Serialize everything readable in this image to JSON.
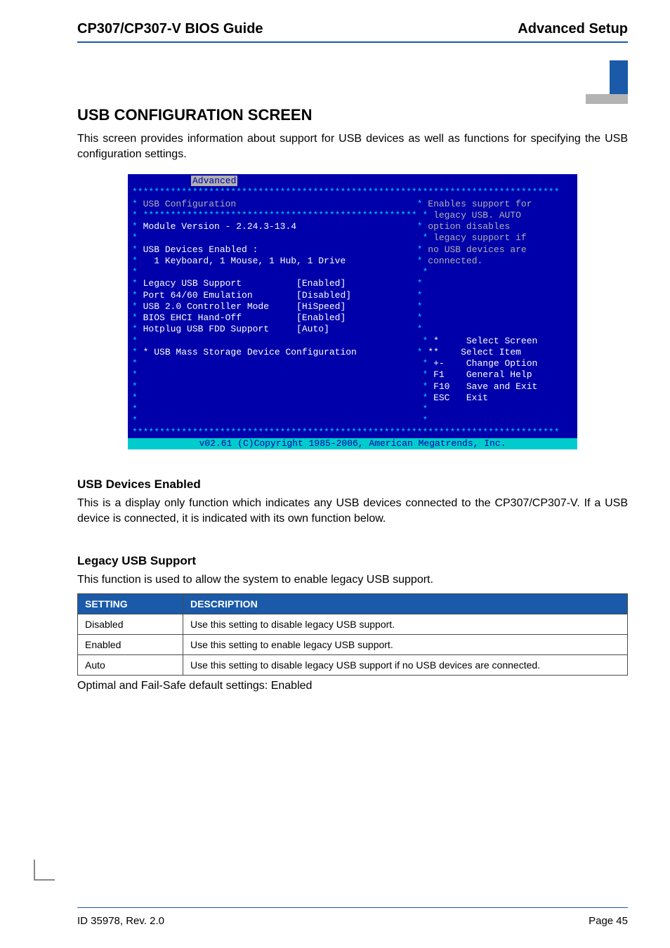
{
  "header": {
    "left": "CP307/CP307-V BIOS Guide",
    "right": "Advanced Setup"
  },
  "section": {
    "title": "USB CONFIGURATION SCREEN",
    "intro": "This screen provides information about support for USB devices as well as functions for specifying the USB configuration settings."
  },
  "bios": {
    "menu_tab": "Advanced",
    "heading": "USB Configuration",
    "module_version": "Module Version - 2.24.3-13.4",
    "devices_enabled_label": "USB Devices Enabled :",
    "devices_enabled_list": "  1 Keyboard, 1 Mouse, 1 Hub, 1 Drive",
    "options": [
      {
        "label": "Legacy USB Support",
        "value": "[Enabled]"
      },
      {
        "label": "Port 64/60 Emulation",
        "value": "[Disabled]"
      },
      {
        "label": "USB 2.0 Controller Mode",
        "value": "[HiSpeed]"
      },
      {
        "label": "BIOS EHCI Hand-Off",
        "value": "[Enabled]"
      },
      {
        "label": "Hotplug USB FDD Support",
        "value": "[Auto]"
      }
    ],
    "submenu": "* USB Mass Storage Device Configuration",
    "help_lines": [
      "Enables support for",
      "legacy USB. AUTO",
      "option disables",
      "legacy support if",
      "no USB devices are",
      "connected."
    ],
    "nav": [
      {
        "key": "*",
        "label": "Select Screen"
      },
      {
        "key": "**",
        "label": "Select Item"
      },
      {
        "key": "+-",
        "label": "Change Option"
      },
      {
        "key": "F1",
        "label": "General Help"
      },
      {
        "key": "F10",
        "label": "Save and Exit"
      },
      {
        "key": "ESC",
        "label": "Exit"
      }
    ],
    "footer": "v02.61 (C)Copyright 1985-2006, American Megatrends, Inc."
  },
  "subsections": {
    "usb_devices_enabled": {
      "title": "USB Devices Enabled",
      "text": "This is a display only function which indicates any USB devices connected to the CP307/CP307-V. If a USB device is connected, it is indicated with its own function below."
    },
    "legacy_usb_support": {
      "title": "Legacy USB Support",
      "text": "This function is used to allow the system to enable legacy USB support."
    }
  },
  "table": {
    "headers": {
      "setting": "SETTING",
      "description": "DESCRIPTION"
    },
    "rows": [
      {
        "setting": "Disabled",
        "description": "Use this setting to disable legacy USB support."
      },
      {
        "setting": "Enabled",
        "description": "Use this setting to enable legacy USB support."
      },
      {
        "setting": "Auto",
        "description": "Use this setting to disable legacy USB support if no USB devices are connected."
      }
    ]
  },
  "defaults_note": "Optimal and Fail-Safe default settings: Enabled",
  "footer": {
    "left": "ID 35978, Rev. 2.0",
    "right": "Page 45"
  }
}
